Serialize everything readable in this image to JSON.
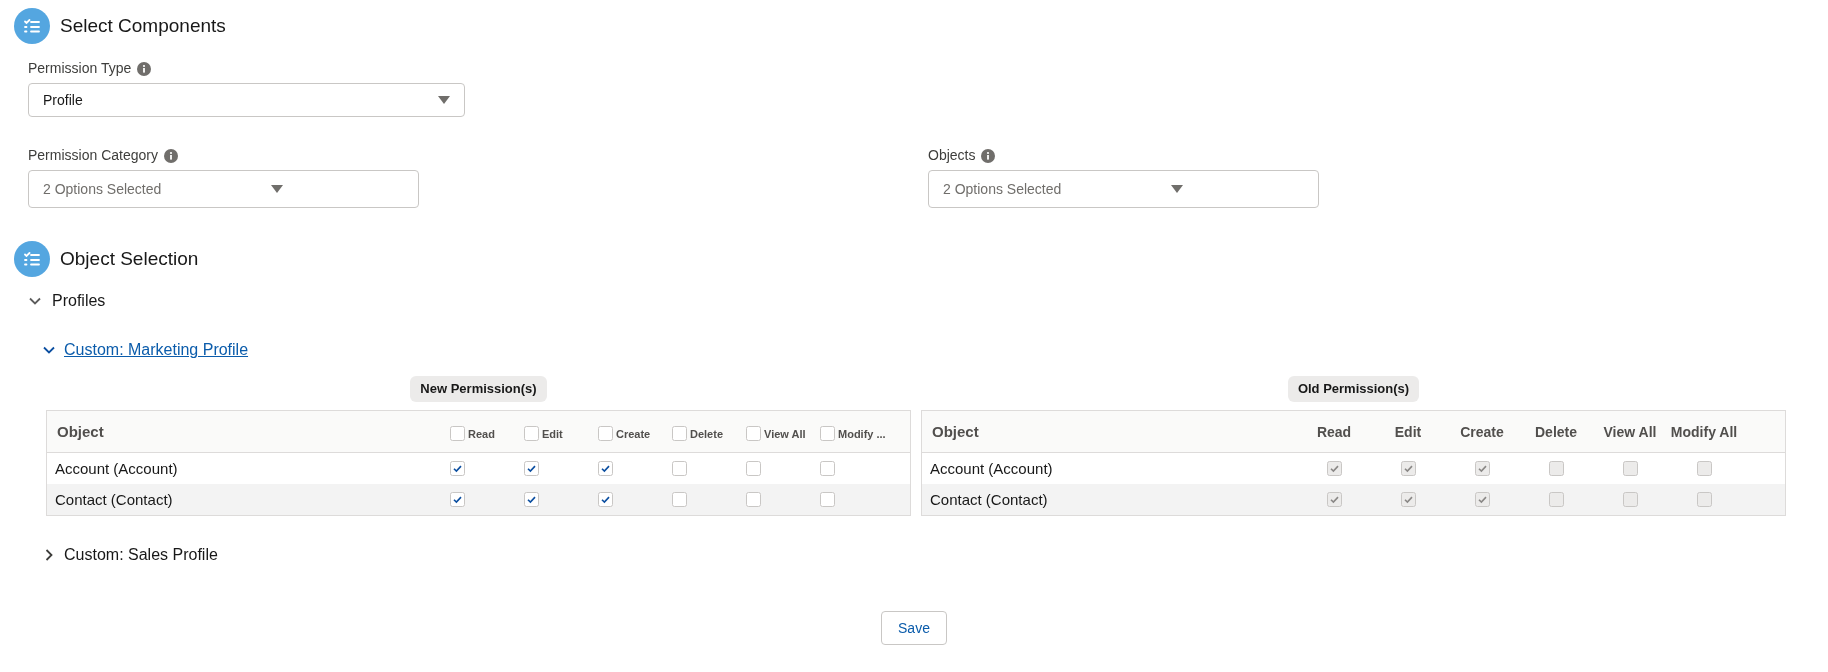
{
  "select_components": {
    "title": "Select Components",
    "fields": [
      {
        "label": "Permission Type",
        "value": "Profile",
        "kind": "single"
      },
      {
        "label": "Permission Category",
        "placeholder": "2 Options Selected",
        "kind": "multi"
      },
      {
        "label": "Objects",
        "placeholder": "2 Options Selected",
        "kind": "multi"
      }
    ]
  },
  "object_selection": {
    "title": "Object Selection",
    "groups": [
      {
        "label": "Profiles",
        "expanded": true,
        "children": [
          {
            "label": "Custom: Marketing Profile",
            "expanded": true,
            "tables": [
              {
                "title": "New Permission(s)",
                "disabled": false,
                "object_header": "Object",
                "columns": [
                  {
                    "label": "Read",
                    "checked": false
                  },
                  {
                    "label": "Edit",
                    "checked": false
                  },
                  {
                    "label": "Create",
                    "checked": false
                  },
                  {
                    "label": "Delete",
                    "checked": false
                  },
                  {
                    "label": "View All",
                    "checked": false
                  },
                  {
                    "label": "Modify ...",
                    "checked": false
                  }
                ],
                "rows": [
                  {
                    "object": "Account (Account)",
                    "permissions": [
                      {
                        "checked": true
                      },
                      {
                        "checked": true
                      },
                      {
                        "checked": true
                      },
                      {
                        "checked": false
                      },
                      {
                        "checked": false
                      },
                      {
                        "checked": false
                      }
                    ]
                  },
                  {
                    "object": "Contact (Contact)",
                    "permissions": [
                      {
                        "checked": true
                      },
                      {
                        "checked": true
                      },
                      {
                        "checked": true
                      },
                      {
                        "checked": false
                      },
                      {
                        "checked": false
                      },
                      {
                        "checked": false
                      }
                    ]
                  }
                ]
              },
              {
                "title": "Old Permission(s)",
                "disabled": true,
                "object_header": "Object",
                "columns": [
                  {
                    "label": "Read"
                  },
                  {
                    "label": "Edit"
                  },
                  {
                    "label": "Create"
                  },
                  {
                    "label": "Delete"
                  },
                  {
                    "label": "View All"
                  },
                  {
                    "label": "Modify All"
                  }
                ],
                "rows": [
                  {
                    "object": "Account (Account)",
                    "permissions": [
                      {
                        "checked": true
                      },
                      {
                        "checked": true
                      },
                      {
                        "checked": true
                      },
                      {
                        "checked": false
                      },
                      {
                        "checked": false
                      },
                      {
                        "checked": false
                      }
                    ]
                  },
                  {
                    "object": "Contact (Contact)",
                    "permissions": [
                      {
                        "checked": true
                      },
                      {
                        "checked": true
                      },
                      {
                        "checked": true
                      },
                      {
                        "checked": false
                      },
                      {
                        "checked": false
                      },
                      {
                        "checked": false
                      }
                    ]
                  }
                ]
              }
            ]
          },
          {
            "label": "Custom: Sales Profile",
            "expanded": false
          }
        ]
      }
    ]
  },
  "buttons": [
    {
      "label": "Save"
    }
  ]
}
